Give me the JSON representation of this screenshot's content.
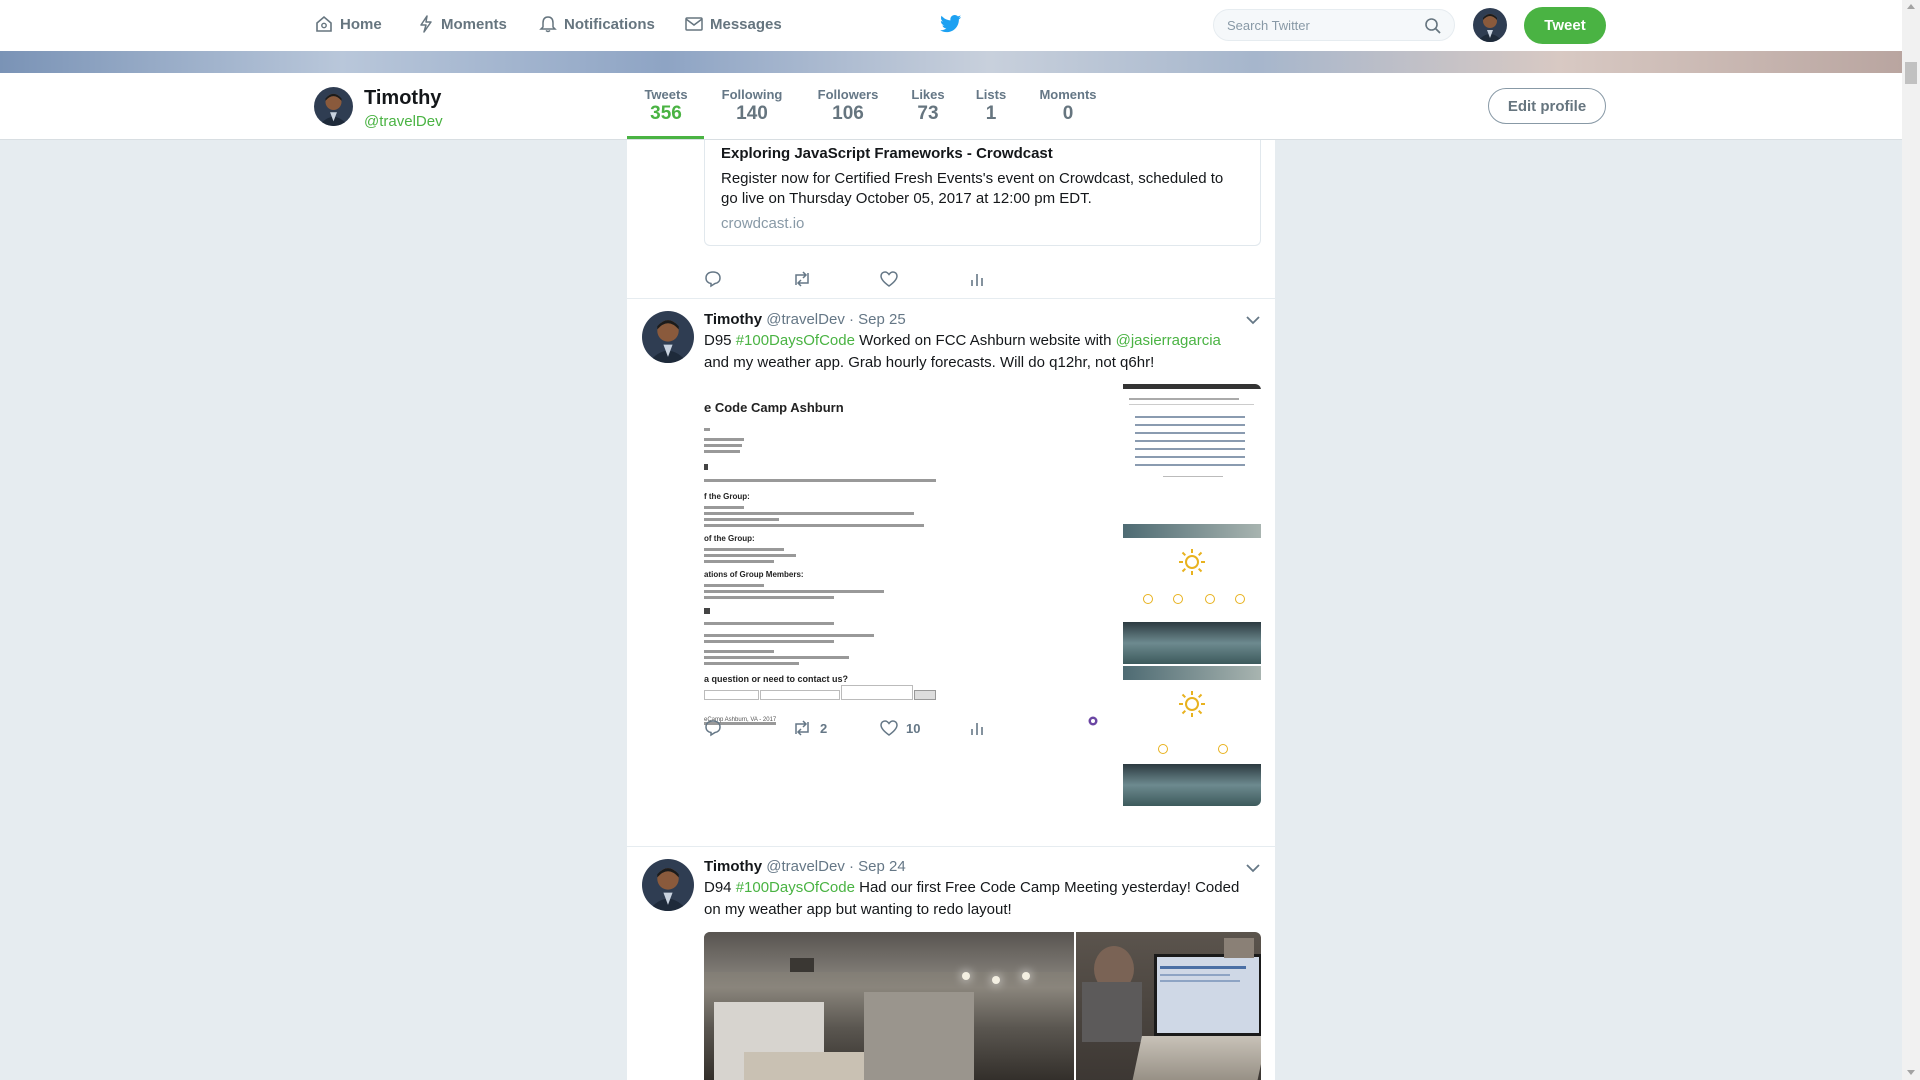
{
  "nav": {
    "items": [
      {
        "label": "Home",
        "icon": "home-icon"
      },
      {
        "label": "Moments",
        "icon": "lightning-icon"
      },
      {
        "label": "Notifications",
        "icon": "bell-icon"
      },
      {
        "label": "Messages",
        "icon": "envelope-icon"
      }
    ],
    "search_placeholder": "Search Twitter",
    "tweet_button": "Tweet"
  },
  "profile": {
    "name": "Timothy",
    "handle": "@travelDev",
    "stats": [
      {
        "label": "Tweets",
        "value": "356"
      },
      {
        "label": "Following",
        "value": "140"
      },
      {
        "label": "Followers",
        "value": "106"
      },
      {
        "label": "Likes",
        "value": "73"
      },
      {
        "label": "Lists",
        "value": "1"
      },
      {
        "label": "Moments",
        "value": "0"
      }
    ],
    "edit_button": "Edit profile"
  },
  "card": {
    "title": "Exploring JavaScript Frameworks - Crowdcast",
    "description": "Register now for Certified Fresh Events's event on Crowdcast, scheduled to go live on Thursday October 05, 2017 at 12:00 pm EDT.",
    "link": "crowdcast.io"
  },
  "tweets": [
    {
      "name": "Timothy",
      "handle": "@travelDev",
      "date": "· Sep 25",
      "text_prefix": "D95 ",
      "hashtag": "#100DaysOfCode",
      "text_middle": " Worked on FCC Ashburn website with ",
      "mention": "@jasierragarcia",
      "text_suffix": " and my weather app. Grab hourly forecasts. Will do q12hr, not q6hr!",
      "retweets": "2",
      "likes": "10",
      "media_site": {
        "title": "e Code Camp Ashburn",
        "about_heading": "f the Group:",
        "goals_heading": "of the Group:",
        "qualifications_heading": "ations of Group Members:",
        "contact_heading": "a question or need to contact us?",
        "footer": "eCamp Ashburn, VA - 2017"
      }
    },
    {
      "name": "Timothy",
      "handle": "@travelDev",
      "date": "· Sep 24",
      "text_prefix": "D94 ",
      "hashtag": "#100DaysOfCode",
      "text_suffix": " Had our first Free Code Camp Meeting yesterday! Coded on my weather app but wanting to redo layout!"
    }
  ]
}
